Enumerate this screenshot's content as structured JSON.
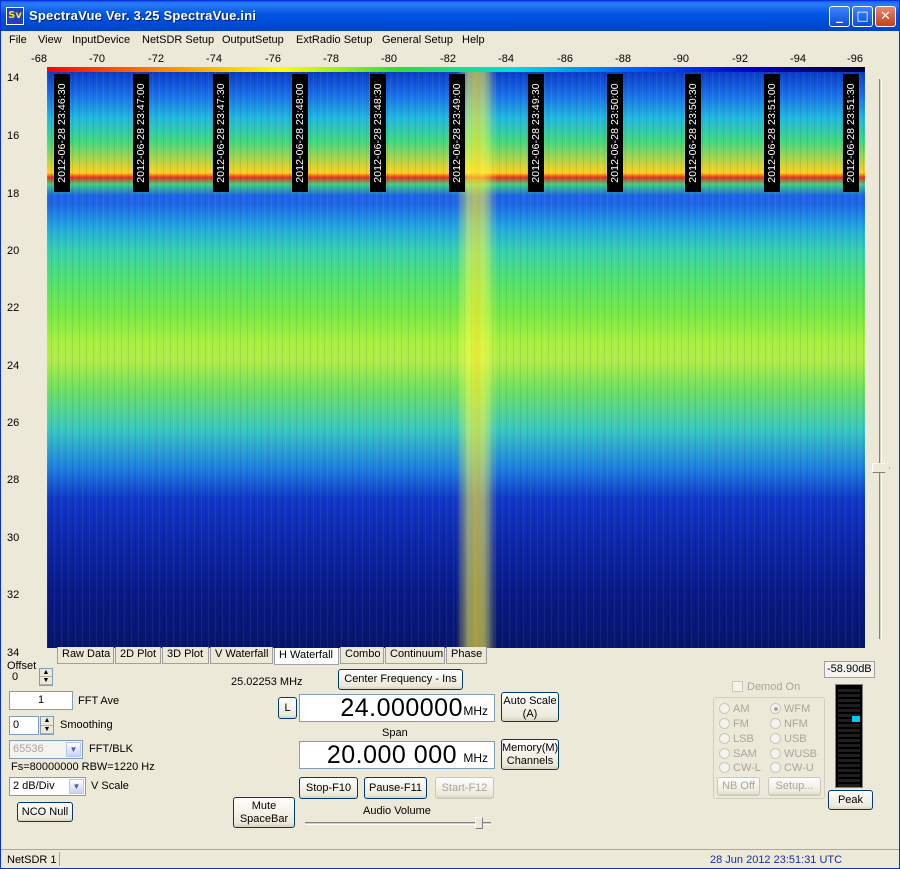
{
  "window": {
    "title": "SpectraVue Ver.  3.25  SpectraVue.ini",
    "icon_text": "Sv"
  },
  "window_controls": {
    "minimize": "_",
    "maximize": "□",
    "close": "✕"
  },
  "menu": [
    "File",
    "View",
    "InputDevice",
    "NetSDR Setup",
    "OutputSetup",
    "ExtRadio Setup",
    "General Setup",
    "Help"
  ],
  "freq_scale": [
    "-68",
    "-70",
    "-72",
    "-74",
    "-76",
    "-78",
    "-80",
    "-82",
    "-84",
    "-86",
    "-88",
    "-90",
    "-92",
    "-94",
    "-96"
  ],
  "time_scale": [
    "14",
    "16",
    "18",
    "20",
    "22",
    "24",
    "26",
    "28",
    "30",
    "32",
    "34"
  ],
  "timestamps": [
    "2012-06-28 23:46:30",
    "2012-06-28 23:47:00",
    "2012-06-28 23:47:30",
    "2012-06-28 23:48:00",
    "2012-06-28 23:48:30",
    "2012-06-28 23:49:00",
    "2012-06-28 23:49:30",
    "2012-06-28 23:50:00",
    "2012-06-28 23:50:30",
    "2012-06-28 23:51:00",
    "2012-06-28 23:51:30"
  ],
  "tabs": [
    "Raw Data",
    "2D Plot",
    "3D Plot",
    "V Waterfall",
    "H Waterfall",
    "Combo",
    "Continuum",
    "Phase"
  ],
  "active_tab": "H Waterfall",
  "controls": {
    "offset_label": "Offset",
    "offset_value": "0",
    "fft_ave_value": "1",
    "fft_ave_label": "FFT Ave",
    "smoothing_value": "0",
    "smoothing_label": "Smoothing",
    "fft_blk_value": "65536",
    "fft_blk_label": "FFT/BLK",
    "fs_text": "Fs=80000000 RBW=1220 Hz",
    "vscale_value": "2 dB/Div",
    "vscale_label": "V Scale",
    "nco_null": "NCO Null"
  },
  "center": {
    "cursor_freq": "25.02253 MHz",
    "center_freq_button": "Center Frequency - Ins",
    "l_button": "L",
    "center_value": "24.000000",
    "center_unit": "MHz",
    "span_label": "Span",
    "span_value": "20.000 000",
    "span_unit": "MHz",
    "auto_scale": "Auto Scale",
    "auto_scale_key": "(A)",
    "memory": "Memory(M)",
    "channels": "Channels",
    "mute": "Mute",
    "mute_key": "SpaceBar",
    "stop": "Stop-F10",
    "pause": "Pause-F11",
    "start": "Start-F12",
    "audio_volume": "Audio Volume"
  },
  "demod": {
    "label": "Demod On",
    "modes": [
      "AM",
      "WFM",
      "FM",
      "NFM",
      "LSB",
      "USB",
      "SAM",
      "WUSB",
      "CW-L",
      "CW-U"
    ],
    "selected": "WFM",
    "nb_off": "NB Off",
    "setup": "Setup..."
  },
  "level": {
    "readout": "-58.90dB",
    "peak": "Peak",
    "meter_level": 0.68
  },
  "status": {
    "device": "NetSDR 1",
    "datetime": "28 Jun 2012  23:51:31 UTC"
  },
  "colors": {
    "title_bar": "#0054e3",
    "face": "#ece9d8",
    "status_date": "#1a2fa0"
  }
}
